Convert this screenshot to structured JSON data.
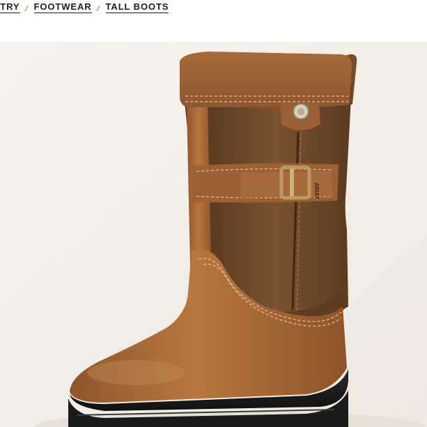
{
  "breadcrumb": {
    "items": [
      {
        "label": "NTRY"
      },
      {
        "label": "FOOTWEAR"
      },
      {
        "label": "TALL BOOTS"
      }
    ],
    "separator": "/"
  },
  "product_image": {
    "subject": "tall-brown-leather-boot",
    "buckle_brand_text": "ARIAT"
  },
  "colors": {
    "text": "#1d1d1d",
    "separator_accent": "#c6892f",
    "image_background": "#f3efea",
    "boot_leather": "#a8683a",
    "boot_panel": "#6e4a2a",
    "sole": "#1f1f1f"
  }
}
